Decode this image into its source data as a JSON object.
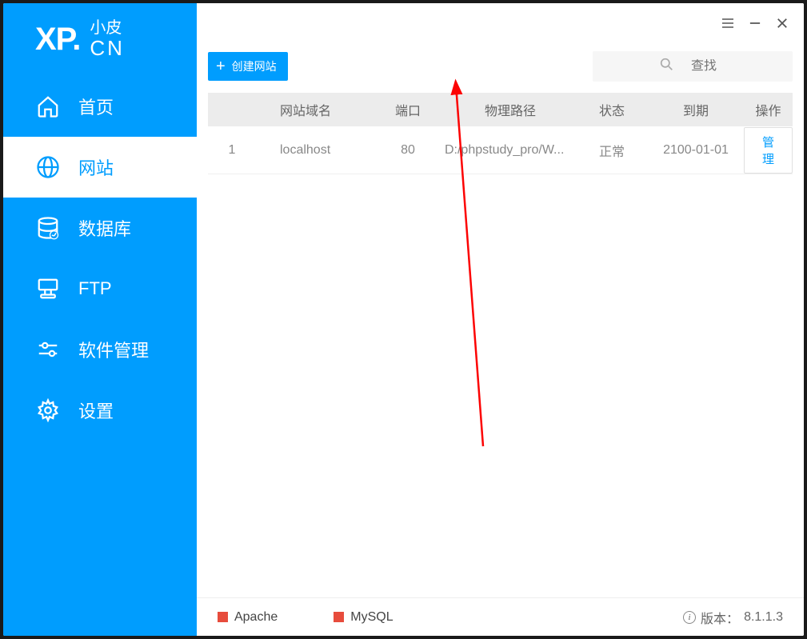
{
  "logo": {
    "main": "XP.",
    "top": "小皮",
    "bottom": "CN"
  },
  "sidebar": {
    "items": [
      {
        "label": "首页",
        "icon": "home"
      },
      {
        "label": "网站",
        "icon": "globe"
      },
      {
        "label": "数据库",
        "icon": "database"
      },
      {
        "label": "FTP",
        "icon": "ftp"
      },
      {
        "label": "软件管理",
        "icon": "settings-sliders"
      },
      {
        "label": "设置",
        "icon": "gear"
      }
    ]
  },
  "toolbar": {
    "create_label": "创建网站",
    "search_placeholder": "查找"
  },
  "table": {
    "headers": {
      "domain": "网站域名",
      "port": "端口",
      "path": "物理路径",
      "status": "状态",
      "expire": "到期",
      "action": "操作"
    },
    "rows": [
      {
        "index": "1",
        "domain": "localhost",
        "port": "80",
        "path": "D:/phpstudy_pro/W...",
        "status": "正常",
        "expire": "2100-01-01",
        "action": "管理"
      }
    ]
  },
  "statusbar": {
    "services": [
      {
        "name": "Apache"
      },
      {
        "name": "MySQL"
      }
    ],
    "version_label": "版本：",
    "version_value": "8.1.1.3"
  }
}
